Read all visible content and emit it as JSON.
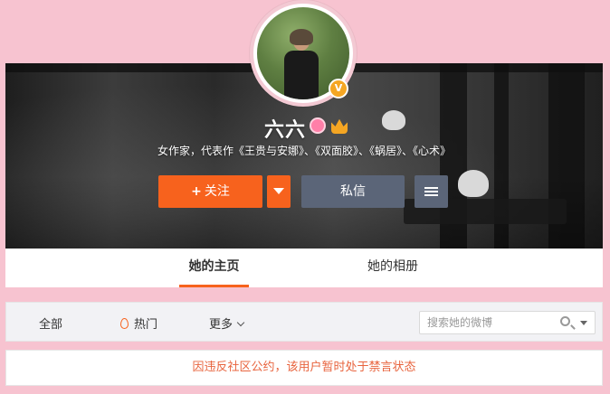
{
  "profile": {
    "name": "六六",
    "verified_badge": "V",
    "bio": "女作家，代表作《王贵与安娜》、《双面胶》、《蜗居》、《心术》"
  },
  "actions": {
    "follow_label": "关注",
    "follow_icon": "+",
    "message_label": "私信"
  },
  "tabs": [
    {
      "label": "她的主页",
      "active": true
    },
    {
      "label": "她的相册",
      "active": false
    }
  ],
  "filters": {
    "all": "全部",
    "hot": "热门",
    "more": "更多"
  },
  "search": {
    "placeholder": "搜索她的微博"
  },
  "notice": {
    "text": "因违反社区公约，该用户暂时处于禁言状态"
  },
  "colors": {
    "background": "#f7c3d0",
    "accent": "#f7621d",
    "secondary_button": "#5b6578",
    "notice_text": "#e8643e"
  }
}
